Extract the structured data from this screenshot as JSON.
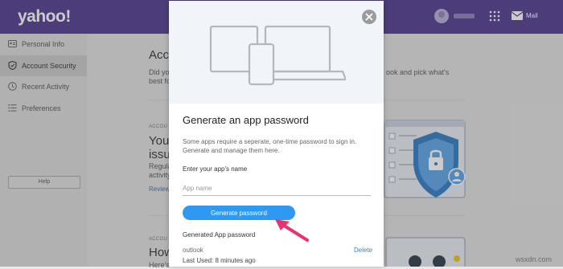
{
  "header": {
    "logo": "yahoo!",
    "mail_label": "Mail",
    "icons": [
      "avatar",
      "apps-grid-icon",
      "mail-icon"
    ]
  },
  "sidebar": {
    "items": [
      {
        "label": "Personal Info",
        "icon": "person-card-icon",
        "active": false
      },
      {
        "label": "Account Security",
        "icon": "shield-icon",
        "active": true
      },
      {
        "label": "Recent Activity",
        "icon": "clock-icon",
        "active": false
      },
      {
        "label": "Preferences",
        "icon": "list-icon",
        "active": false
      }
    ],
    "help_label": "Help"
  },
  "background": {
    "title_partial": "Acc",
    "intro_line1": "Did yo",
    "intro_line2": "best fo",
    "intro_right1": "ook and pick what's",
    "intro_right2": "",
    "section1_tag": "ACCOU",
    "section1_title_line1": "Your",
    "section1_title_line2": "issue",
    "section1_text_line1": "Regula",
    "section1_text_line2": "activity",
    "section1_link": "Review",
    "section2_tag": "ACCOU",
    "section2_title": "How",
    "section2_text": "Here's"
  },
  "modal": {
    "title": "Generate an app password",
    "description": "Some apps require a seperate, one-time password to sign in. Generate and manage them here.",
    "input_label": "Enter your app's name",
    "input_placeholder": "App name",
    "input_value": "",
    "generate_button": "Generate password",
    "generated_label": "Generated App password",
    "app_entry_name": "outlook",
    "delete_label": "Delete",
    "last_used": "Last Used: 8 minutes ago",
    "close_icon": "close-icon",
    "hero_icon": "devices-illustration-icon"
  },
  "colors": {
    "header_bg": "#4f3a8f",
    "button_blue": "#2f98f0",
    "arrow_pink": "#e8336e",
    "link_blue": "#3b82d6"
  },
  "watermark": "wsxdn.com"
}
